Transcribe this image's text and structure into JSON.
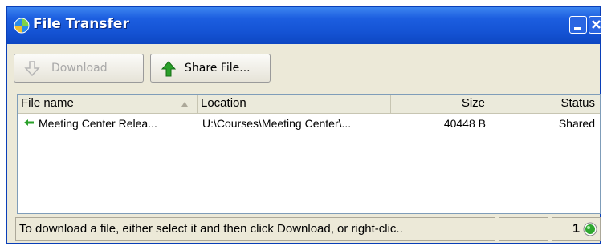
{
  "window": {
    "title": "File Transfer",
    "controls": {
      "minimize_icon": "minimize-icon",
      "close_icon": "close-icon"
    }
  },
  "toolbar": {
    "download_label": "Download",
    "download_enabled": false,
    "share_label": "Share File..."
  },
  "table": {
    "columns": [
      "File name",
      "Location",
      "Size",
      "Status"
    ],
    "rows": [
      {
        "name": "Meeting Center Relea...",
        "location": "U:\\Courses\\Meeting Center\\...",
        "size": "40448 B",
        "status": "Shared"
      }
    ]
  },
  "statusbar": {
    "message": "To download a file, either select it and then click Download, or right-clic..",
    "count": "1",
    "connection_color": "#2fa82f"
  },
  "colors": {
    "titlebar": "#1452d3",
    "share_arrow": "#2aa02a",
    "download_arrow_disabled": "#b5b5b5"
  }
}
